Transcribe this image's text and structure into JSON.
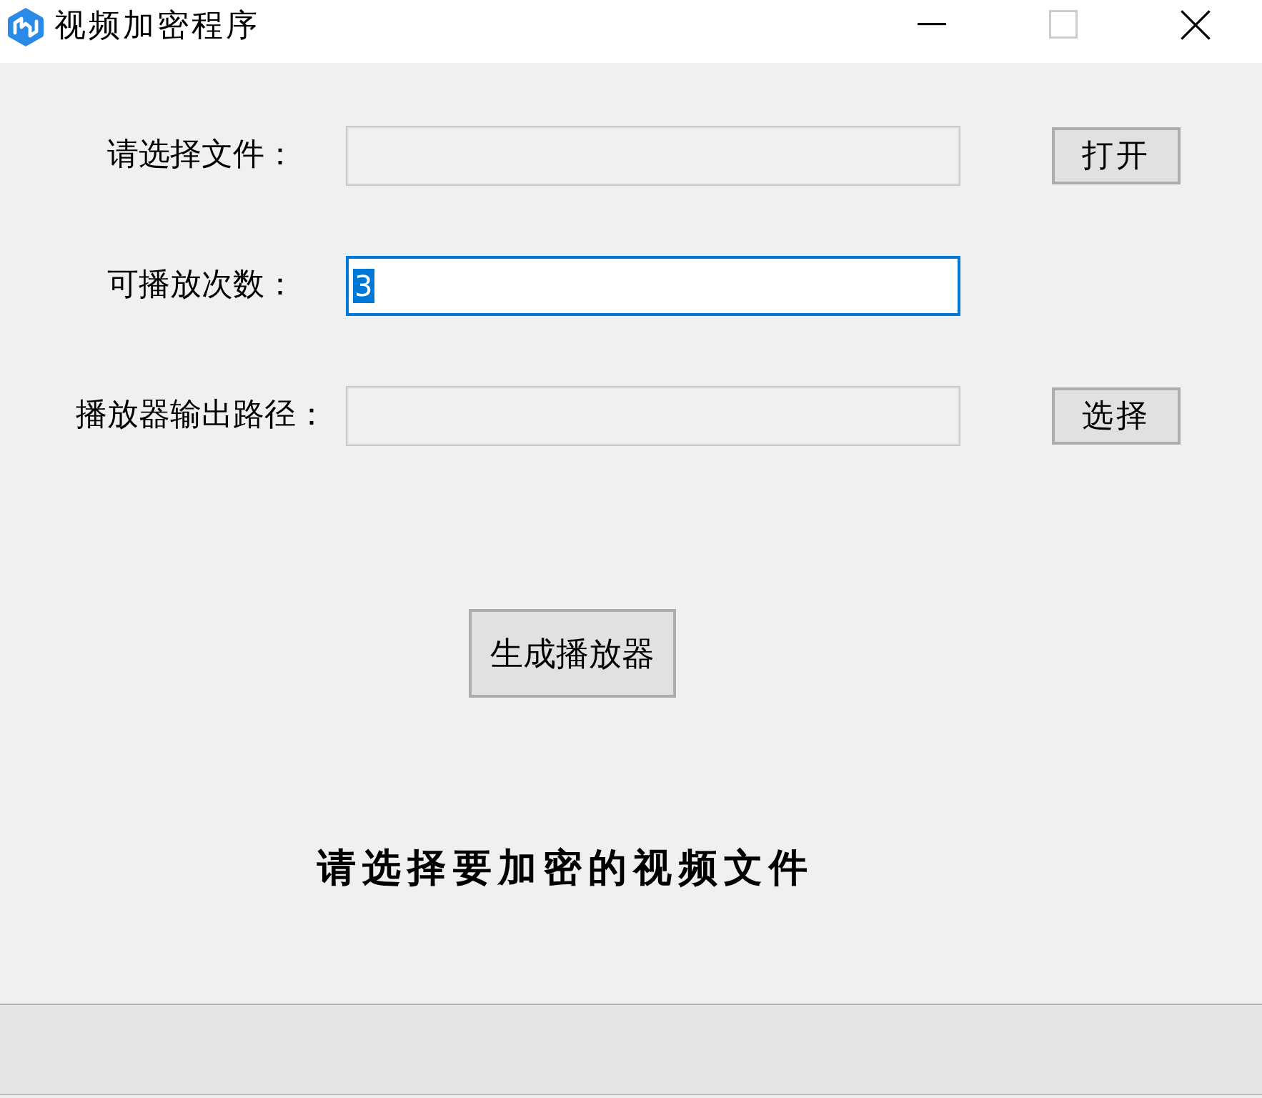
{
  "window": {
    "title": "视频加密程序",
    "controls": [
      {
        "kind": "minimize",
        "disabled": false
      },
      {
        "kind": "maximize",
        "disabled": true
      },
      {
        "kind": "close",
        "disabled": false
      }
    ]
  },
  "form": {
    "rows": [
      {
        "label": "请选择文件：",
        "field": {
          "readonly": true,
          "focused": false
        },
        "button": "打开"
      },
      {
        "label": "可播放次数：",
        "field": {
          "value": "3",
          "readonly": false,
          "focused": true,
          "text_selected": true
        }
      },
      {
        "label": "播放器输出路径：",
        "field": {
          "readonly": true,
          "focused": false
        },
        "button": "选择"
      }
    ],
    "generate_button": "生成播放器",
    "status_message": "请选择要加密的视频文件"
  }
}
